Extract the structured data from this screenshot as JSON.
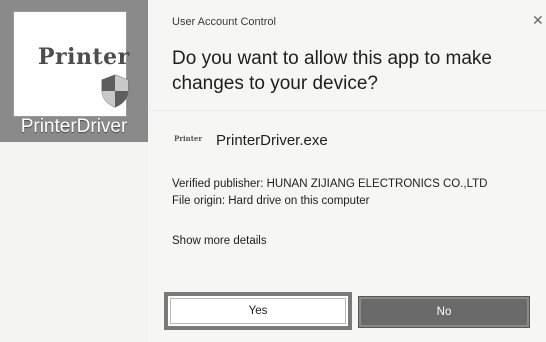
{
  "desktop": {
    "shortcut": {
      "logo_text": "Printer",
      "label": "PrinterDriver",
      "icon": "printer-shield-icon"
    }
  },
  "dialog": {
    "title": "User Account Control",
    "close_icon": "close-icon",
    "question": "Do you want to allow this app to make changes to your device?",
    "app": {
      "mini_logo_text": "Printer",
      "name": "PrinterDriver.exe"
    },
    "publisher": "Verified publisher: HUNAN ZIJIANG ELECTRONICS CO.,LTD",
    "origin": "File origin: Hard drive on this computer",
    "more_details": "Show more details",
    "buttons": {
      "yes": "Yes",
      "no": "No"
    }
  },
  "colors": {
    "dialog_background": "#f6f6f4",
    "no_button": "#6a6a6a",
    "yes_button_border": "#7a7a7a"
  }
}
